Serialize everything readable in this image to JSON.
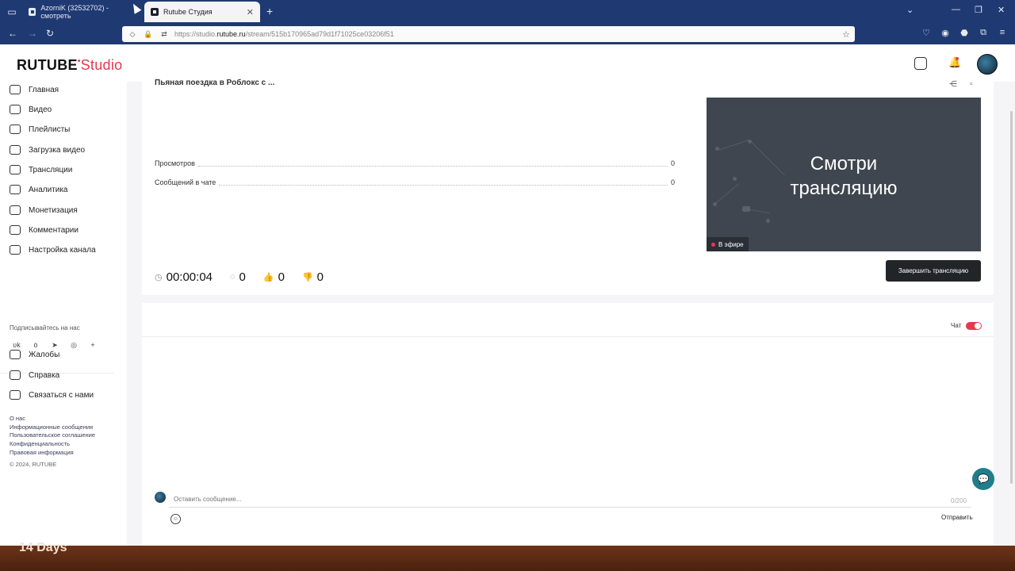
{
  "browser": {
    "tabs": [
      {
        "title": "AzorniK (32532702) - смотреть",
        "active": false
      },
      {
        "title": "Rutube Студия",
        "active": true
      }
    ],
    "url_prefix": "https://studio.",
    "url_domain": "rutube.ru",
    "url_path": "/stream/515b170965ad79d1f71025ce03206f51"
  },
  "header": {
    "logo_main": "RUTUBE",
    "logo_dot": "•",
    "logo_studio": "Studio"
  },
  "sidebar": {
    "items": [
      {
        "label": "Главная",
        "name": "home"
      },
      {
        "label": "Видео",
        "name": "video"
      },
      {
        "label": "Плейлисты",
        "name": "playlists"
      },
      {
        "label": "Загрузка видео",
        "name": "upload-video"
      },
      {
        "label": "Трансляции",
        "name": "streams"
      },
      {
        "label": "Аналитика",
        "name": "analytics"
      },
      {
        "label": "Монетизация",
        "name": "monetization"
      },
      {
        "label": "Комментарии",
        "name": "comments"
      },
      {
        "label": "Настройка канала",
        "name": "channel-settings"
      }
    ],
    "follow_title": "Подписывайтесь на нас",
    "social": [
      "vk-icon",
      "ok-icon",
      "telegram-icon",
      "viber-icon",
      "plus-icon"
    ],
    "secondary": [
      {
        "label": "Жалобы",
        "name": "complaints"
      },
      {
        "label": "Справка",
        "name": "help"
      },
      {
        "label": "Связаться с нами",
        "name": "contact"
      }
    ],
    "footer_links": [
      "О нас",
      "Информационные сообщения",
      "Пользовательское соглашение",
      "Конфиденциальность",
      "Правовая информация"
    ],
    "copyright": "© 2024, RUTUBE"
  },
  "stream": {
    "title": "Пьяная поездка в Роблокс с ...",
    "stats": [
      {
        "label": "Просмотров",
        "value": "0"
      },
      {
        "label": "Сообщений в чате",
        "value": "0"
      }
    ],
    "preview_line1": "Смотри",
    "preview_line2": "трансляцию",
    "live_badge": "В эфире",
    "timer": "00:00:04",
    "viewers": "0",
    "likes": "0",
    "dislikes": "0",
    "end_button": "Завершить трансляцию"
  },
  "chat": {
    "label": "Чат",
    "enabled": true,
    "placeholder": "Оставить сообщение...",
    "counter": "0/200",
    "send": "Отправить"
  },
  "background_text": "14 Days",
  "colors": {
    "accent": "#e8384f",
    "browser_chrome": "#1f3a73",
    "preview_bg": "#3f4650",
    "help_fab": "#1e7e8c"
  }
}
